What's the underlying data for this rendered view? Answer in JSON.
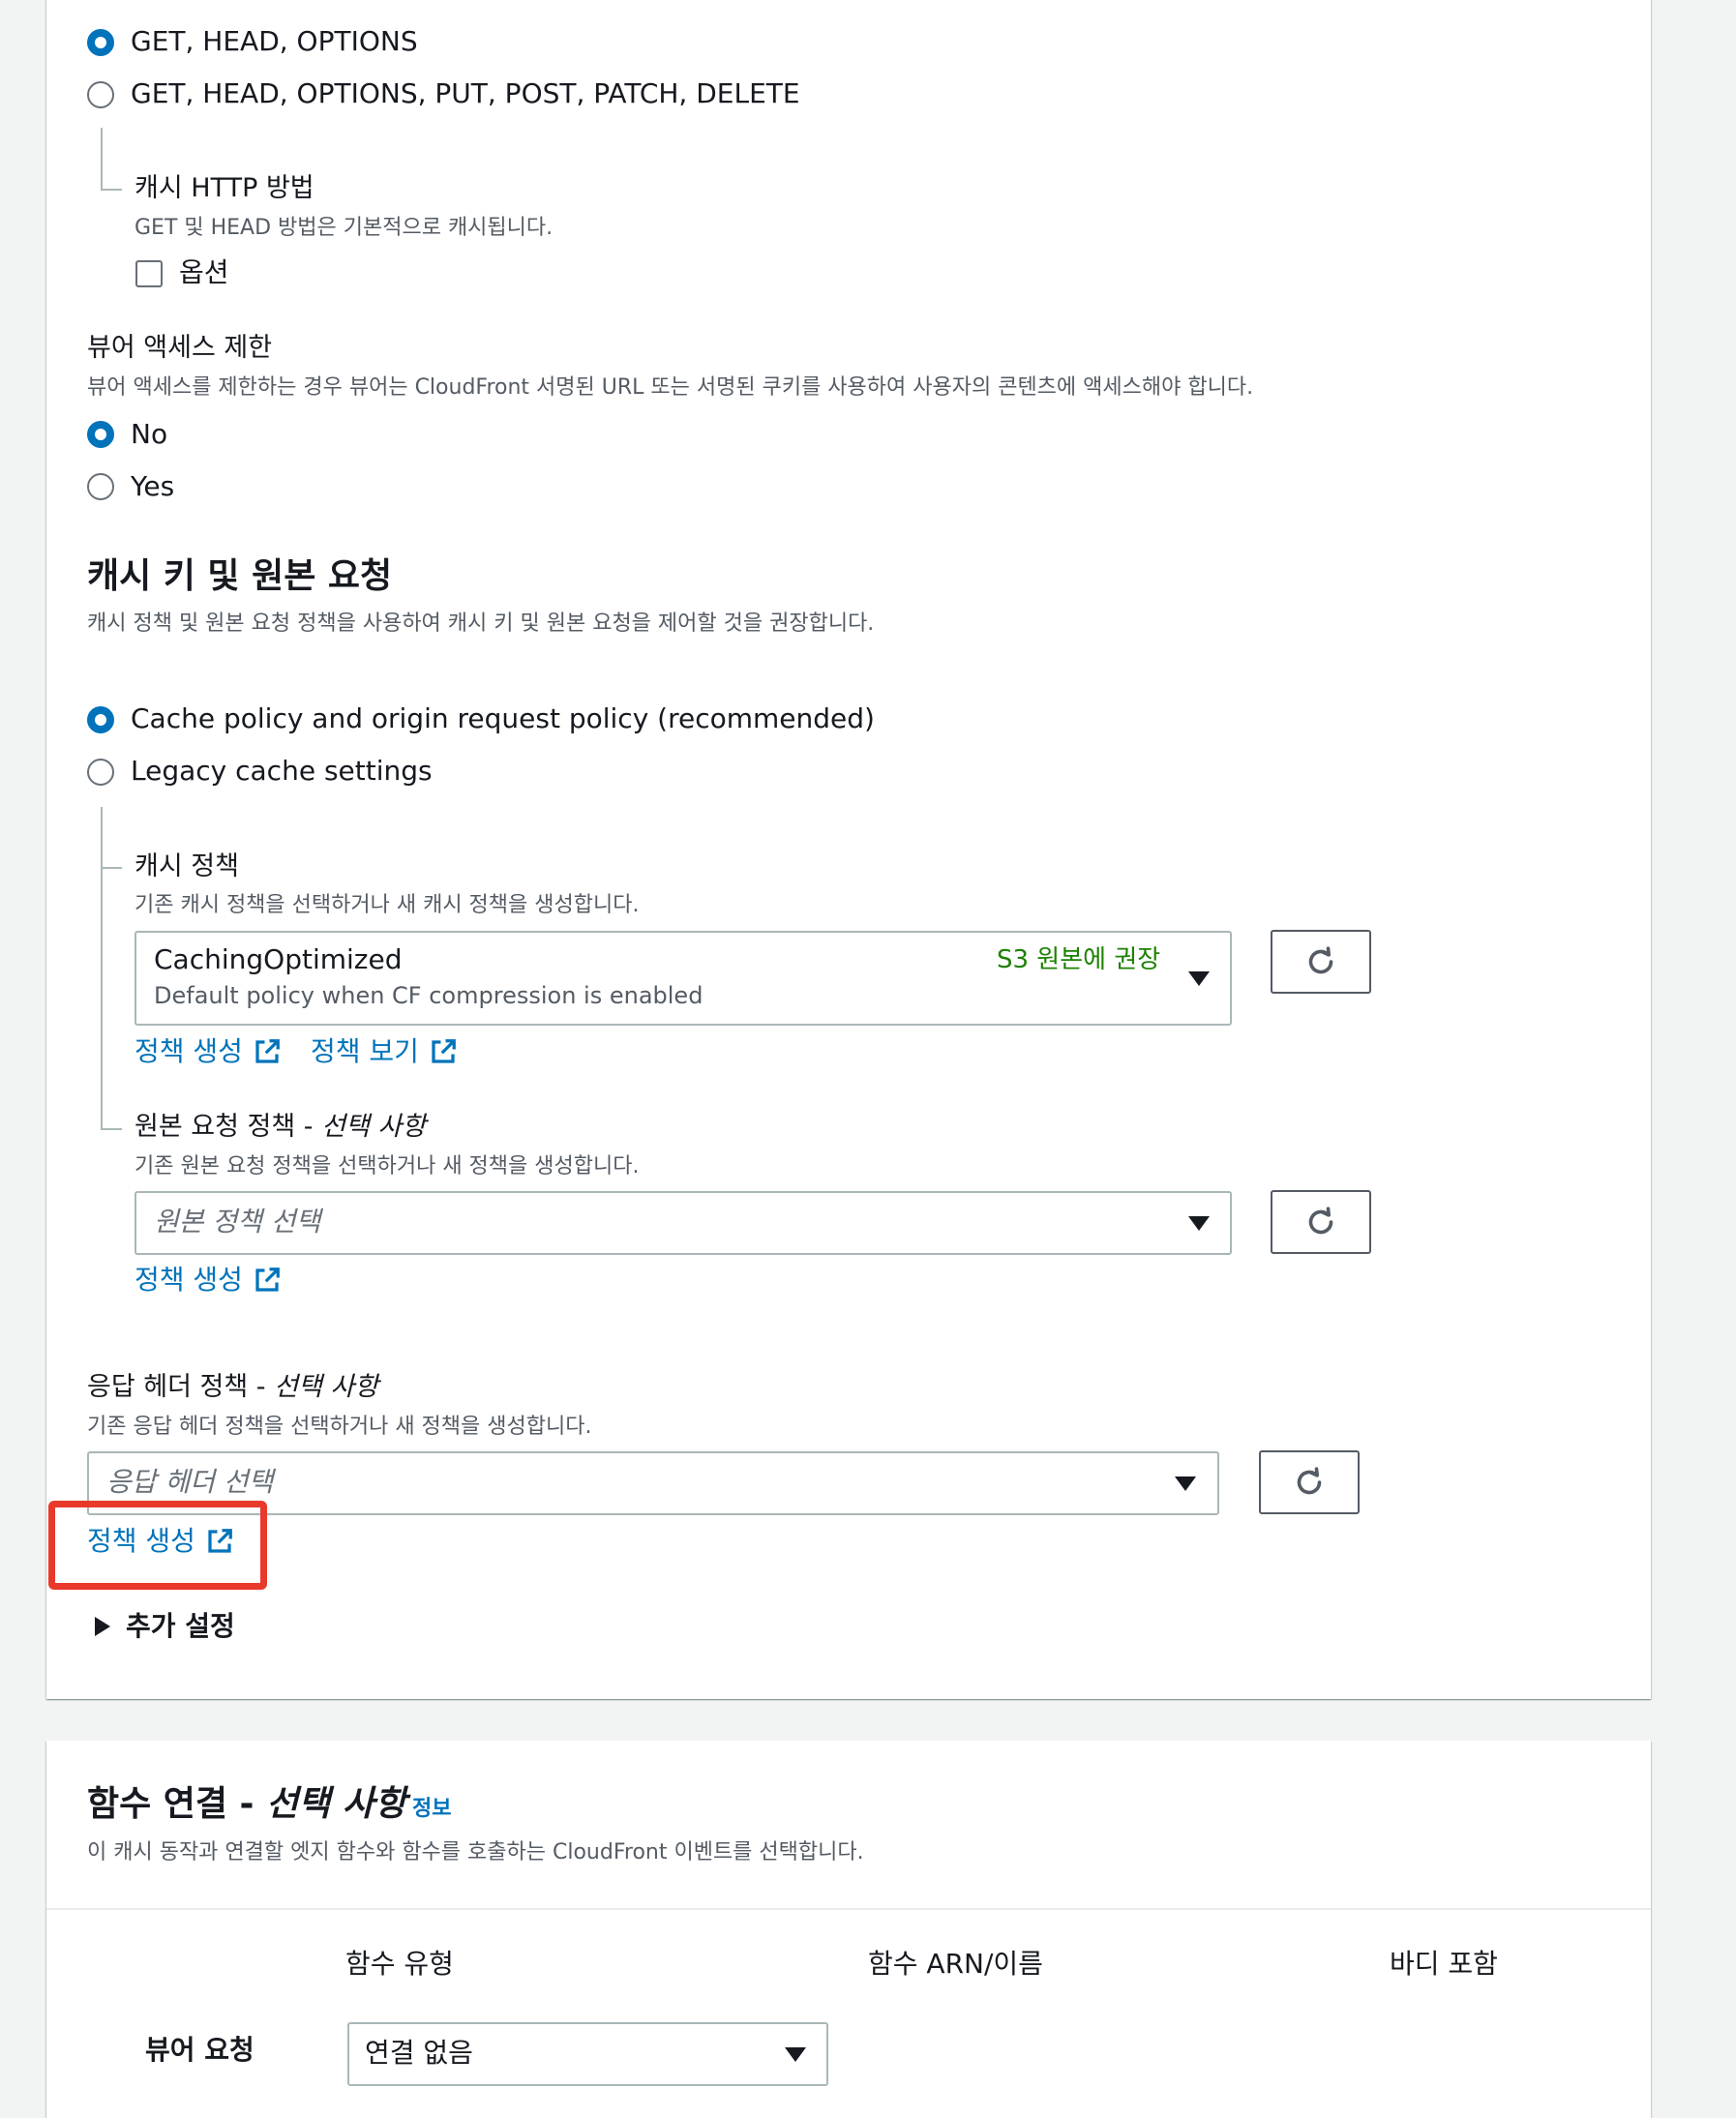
{
  "allowed_methods": {
    "options": [
      {
        "label": "GET, HEAD, OPTIONS",
        "checked": true
      },
      {
        "label": "GET, HEAD, OPTIONS, PUT, POST, PATCH, DELETE",
        "checked": false
      }
    ],
    "cache_http": {
      "label": "캐시 HTTP 방법",
      "description": "GET 및 HEAD 방법은 기본적으로 캐시됩니다.",
      "checkbox_label": "옵션"
    }
  },
  "viewer_access": {
    "label": "뷰어 액세스 제한",
    "description": "뷰어 액세스를 제한하는 경우 뷰어는 CloudFront 서명된 URL 또는 서명된 쿠키를 사용하여 사용자의 콘텐츠에 액세스해야 합니다.",
    "options": [
      {
        "label": "No",
        "checked": true
      },
      {
        "label": "Yes",
        "checked": false
      }
    ]
  },
  "cache_key": {
    "heading": "캐시 키 및 원본 요청",
    "description": "캐시 정책 및 원본 요청 정책을 사용하여 캐시 키 및 원본 요청을 제어할 것을 권장합니다.",
    "options": [
      {
        "label": "Cache policy and origin request policy (recommended)",
        "checked": true
      },
      {
        "label": "Legacy cache settings",
        "checked": false
      }
    ],
    "cache_policy": {
      "label": "캐시 정책",
      "description": "기존 캐시 정책을 선택하거나 새 캐시 정책을 생성합니다.",
      "selected_value": "CachingOptimized",
      "selected_sub": "Default policy when CF compression is enabled",
      "badge": "S3 원본에 권장",
      "create_link": "정책 생성",
      "view_link": "정책 보기"
    },
    "origin_policy": {
      "label_main": "원본 요청 정책 - ",
      "label_optional": "선택 사항",
      "description": "기존 원본 요청 정책을 선택하거나 새 정책을 생성합니다.",
      "placeholder": "원본 정책 선택",
      "create_link": "정책 생성"
    },
    "response_headers": {
      "label_main": "응답 헤더 정책 - ",
      "label_optional": "선택 사항",
      "description": "기존 응답 헤더 정책을 선택하거나 새 정책을 생성합니다.",
      "placeholder": "응답 헤더 선택",
      "create_link": "정책 생성"
    },
    "additional_settings": "추가 설정"
  },
  "function_assoc": {
    "heading_main": "함수 연결 - ",
    "heading_optional": "선택 사항",
    "info": "정보",
    "description": "이 캐시 동작과 연결할 엣지 함수와 함수를 호출하는 CloudFront 이벤트를 선택합니다.",
    "columns": [
      "함수 유형",
      "함수 ARN/이름",
      "바디 포함"
    ],
    "rows": [
      {
        "label": "뷰어 요청",
        "function_type": "연결 없음"
      }
    ]
  },
  "colors": {
    "accent": "#0073bb",
    "highlight": "#e8392b",
    "badge_green": "#1d8102"
  }
}
